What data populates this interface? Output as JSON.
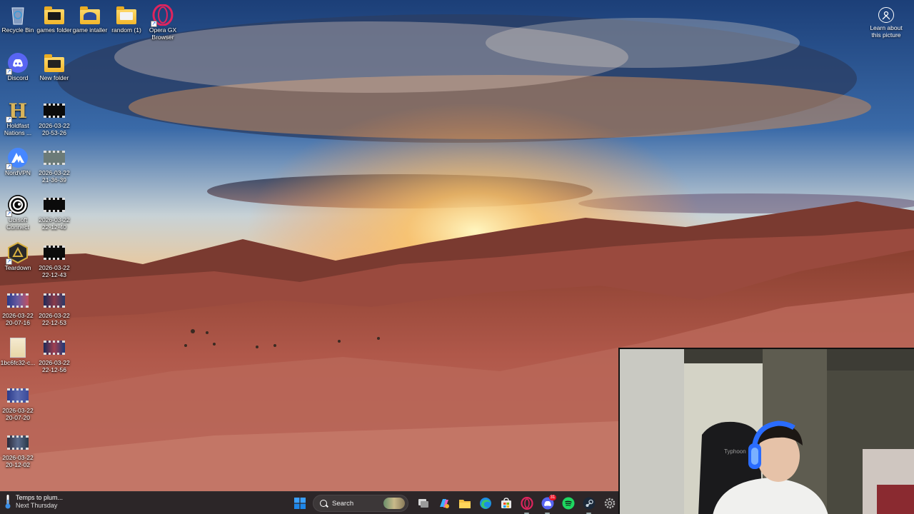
{
  "desktop": {
    "icons": [
      {
        "label": "Recycle Bin",
        "icon": "recycle-bin-icon"
      },
      {
        "label": "games folder",
        "icon": "folder-icon"
      },
      {
        "label": "game intaller",
        "icon": "folder-icon"
      },
      {
        "label": "random (1)",
        "icon": "folder-icon"
      },
      {
        "label": "Opera GX\nBrowser",
        "icon": "opera-gx-icon"
      },
      {
        "label": "Discord",
        "icon": "discord-icon"
      },
      {
        "label": "New folder",
        "icon": "folder-icon"
      },
      {
        "label": "Holdfast\nNations ...",
        "icon": "holdfast-icon"
      },
      {
        "label": "2026-03-22\n20-53-26",
        "icon": "video-file-icon"
      },
      {
        "label": "NordVPN",
        "icon": "nordvpn-icon"
      },
      {
        "label": "2026-03-22\n21-36-39",
        "icon": "video-file-icon"
      },
      {
        "label": "Ubisoft\nConnect",
        "icon": "ubisoft-connect-icon"
      },
      {
        "label": "2026-03-22\n22-12-40",
        "icon": "video-file-icon"
      },
      {
        "label": "Teardown",
        "icon": "teardown-icon"
      },
      {
        "label": "2026-03-22\n22-12-43",
        "icon": "video-file-icon"
      },
      {
        "label": "2026-03-22\n20-07-16",
        "icon": "video-file-icon"
      },
      {
        "label": "2026-03-22\n22-12-53",
        "icon": "video-file-icon"
      },
      {
        "label": "1bc6fc32-c...",
        "icon": "image-file-icon"
      },
      {
        "label": "2026-03-22\n22-12-56",
        "icon": "video-file-icon"
      },
      {
        "label": "2026-03-22\n20-07-20",
        "icon": "video-file-icon"
      },
      {
        "label": "2026-03-22\n20-12-02",
        "icon": "video-file-icon"
      }
    ],
    "learn_about": "Learn about\nthis picture"
  },
  "taskbar": {
    "weather_title": "Temps to plum...",
    "weather_sub": "Next Thursday",
    "search_placeholder": "Search",
    "discord_badge": "31",
    "apps": [
      "start",
      "search",
      "task-view",
      "copilot",
      "file-explorer",
      "edge",
      "microsoft-store",
      "opera-gx",
      "discord",
      "spotify",
      "steam",
      "settings"
    ]
  },
  "webcam": {
    "chair_label": "Typhoon"
  },
  "colors": {
    "taskbar_bg": "#202024",
    "accent": "#0078d4"
  }
}
